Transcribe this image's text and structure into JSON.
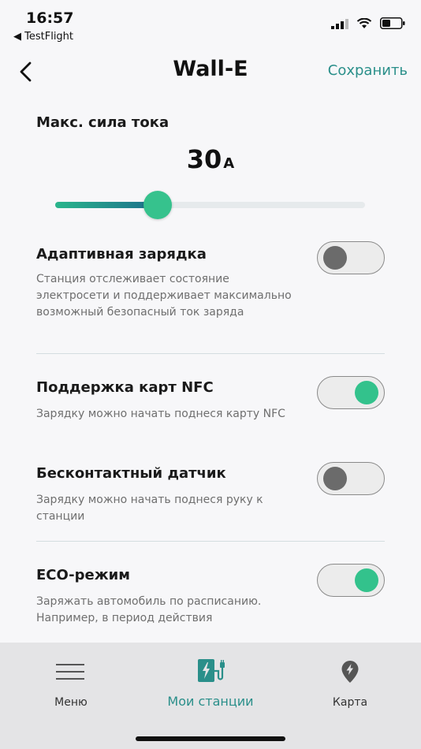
{
  "status_bar": {
    "time": "16:57",
    "back_app": "◀ TestFlight"
  },
  "nav": {
    "title": "Wall-E",
    "save_label": "Сохранить"
  },
  "max_current": {
    "label": "Макс. сила тока",
    "value": "30",
    "unit": "A",
    "slider_fraction": 0.33
  },
  "settings": [
    {
      "title": "Адаптивная зарядка",
      "description": "Станция отслеживает состояние электросети и поддерживает максимально возможный безопасный ток заряда",
      "enabled": false
    },
    {
      "title": "Поддержка карт NFC",
      "description": "Зарядку можно начать поднеся карту NFC",
      "enabled": true
    },
    {
      "title": "Бесконтактный датчик",
      "description": "Зарядку можно начать поднеся руку к станции",
      "enabled": false
    },
    {
      "title": "ECO-режим",
      "description": "Заряжать автомобиль по расписанию. Например, в период действия",
      "enabled": true
    }
  ],
  "tabs": [
    {
      "label": "Меню",
      "icon": "menu-icon",
      "active": false
    },
    {
      "label": "Мои станции",
      "icon": "charging-station-icon",
      "active": true
    },
    {
      "label": "Карта",
      "icon": "map-pin-icon",
      "active": false
    }
  ],
  "colors": {
    "accent": "#2a8f8a",
    "toggle_on": "#33c28c",
    "toggle_off_knob": "#6b6b6b",
    "background": "#f7f7f9",
    "tabbar": "#e4e4e6"
  }
}
